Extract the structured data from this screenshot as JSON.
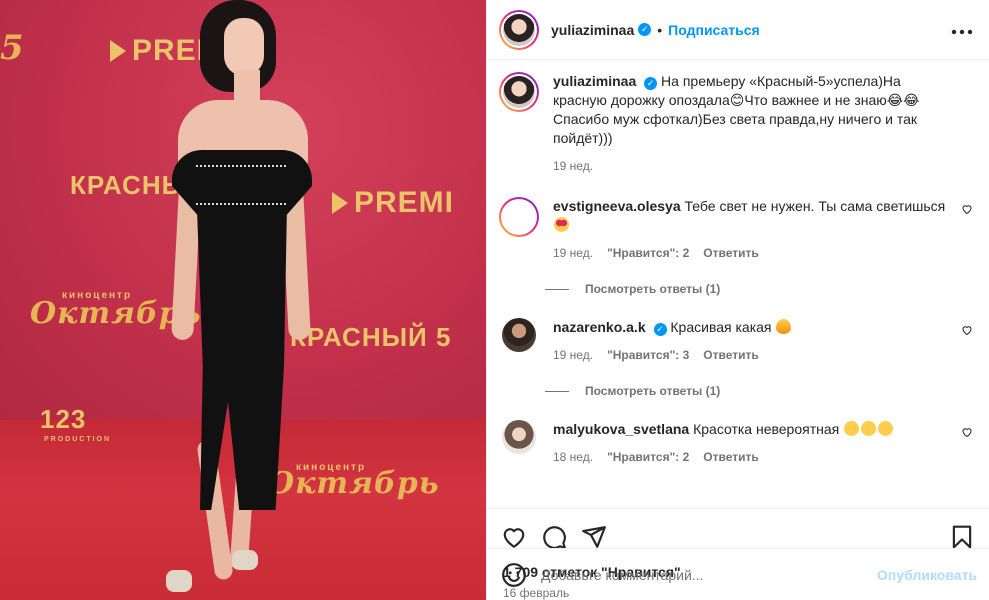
{
  "photo": {
    "logos": [
      "PREMI",
      "КРАСНЫЙ",
      "PREMI",
      "киноцентр",
      "Октябрь",
      "КРАСНЫЙ",
      "5",
      "123",
      "PRODUCTION",
      "киноцентр",
      "Октябрь",
      "5"
    ]
  },
  "post": {
    "author": "yuliaziminaa",
    "follow_label": "Подписаться",
    "dot": "•",
    "more_label": "•••"
  },
  "caption": {
    "username": "yuliaziminaa",
    "text": "На премьеру «Красный-5»успела)На красную дорожку опоздала😊Что важнее и не знаю😂😂 Спасибо муж сфоткал)Без света правда,ну ничего и так пойдёт)))",
    "time": "19 нед."
  },
  "comments": [
    {
      "username": "evstigneeva.olesya",
      "text": "Тебе свет не нужен. Ты сама светишься",
      "emoji": "heart-eyes-emoji",
      "time": "19 нед.",
      "likes": "\"Нравится\": 2",
      "reply": "Ответить",
      "view_replies": "Посмотреть ответы (1)"
    },
    {
      "username": "nazarenko.a.k",
      "text": "Красивая какая",
      "emoji": "fire-emoji",
      "time": "19 нед.",
      "likes": "\"Нравится\": 3",
      "reply": "Ответить",
      "view_replies": "Посмотреть ответы (1)"
    },
    {
      "username": "malyukova_svetlana",
      "text": "Красотка невероятная",
      "emoji": "kiss-emoji",
      "time": "18 нед.",
      "likes": "\"Нравится\": 2",
      "reply": "Ответить"
    }
  ],
  "stats": {
    "likes": "1 709 отметок \"Нравится\"",
    "date": "16 февраль"
  },
  "add_comment": {
    "placeholder": "Добавьте комментарий...",
    "publish": "Опубликовать"
  },
  "colors": {
    "accent": "#0095f6",
    "publish_disabled": "#b3dbff",
    "muted": "#737373"
  }
}
